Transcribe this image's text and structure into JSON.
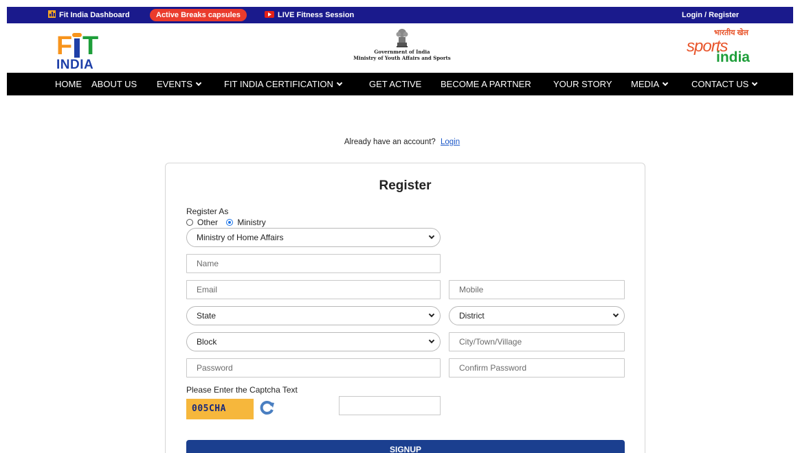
{
  "topbar": {
    "dashboard": "Fit India Dashboard",
    "active_breaks": "Active Breaks capsules",
    "live": "LIVE Fitness Session",
    "login_register": "Login / Register"
  },
  "header": {
    "fit_logo_top": "FIT",
    "fit_logo_bottom": "INDIA",
    "gov_line1": "Government of India",
    "gov_line2": "Ministry of Youth Affairs and Sports",
    "sai_hindi": "भारतीय खेल",
    "sai_sports": "sports",
    "sai_india": "india"
  },
  "nav": [
    {
      "label": "HOME",
      "has_dropdown": false
    },
    {
      "label": "ABOUT US",
      "has_dropdown": false
    },
    {
      "label": "EVENTS",
      "has_dropdown": true
    },
    {
      "label": "FIT INDIA CERTIFICATION",
      "has_dropdown": true
    },
    {
      "label": "GET ACTIVE",
      "has_dropdown": false
    },
    {
      "label": "BECOME A PARTNER",
      "has_dropdown": false
    },
    {
      "label": "YOUR STORY",
      "has_dropdown": false
    },
    {
      "label": "MEDIA",
      "has_dropdown": true
    },
    {
      "label": "CONTACT US",
      "has_dropdown": true
    }
  ],
  "login_prompt": {
    "text": "Already have an account?",
    "link": "Login"
  },
  "form": {
    "title": "Register",
    "register_as_label": "Register As",
    "options": [
      "Other",
      "Ministry"
    ],
    "selected_option": "Ministry",
    "ministry_select": "Ministry of Home Affairs",
    "name_placeholder": "Name",
    "email_placeholder": "Email",
    "mobile_placeholder": "Mobile",
    "state_select": "State",
    "district_select": "District",
    "block_select": "Block",
    "city_placeholder": "City/Town/Village",
    "password_placeholder": "Password",
    "confirm_password_placeholder": "Confirm Password",
    "captcha_label": "Please Enter the Captcha Text",
    "captcha_text": "005CHA",
    "captcha_input_value": "",
    "signup_label": "SIGNUP"
  },
  "colors": {
    "topbar_bg": "#1a1a8c",
    "active_breaks_bg": "#ea3b2c",
    "nav_bg": "#000000",
    "signup_bg": "#1b3f8f",
    "captcha_bg": "#f6b73c",
    "link": "#1a56c8"
  }
}
